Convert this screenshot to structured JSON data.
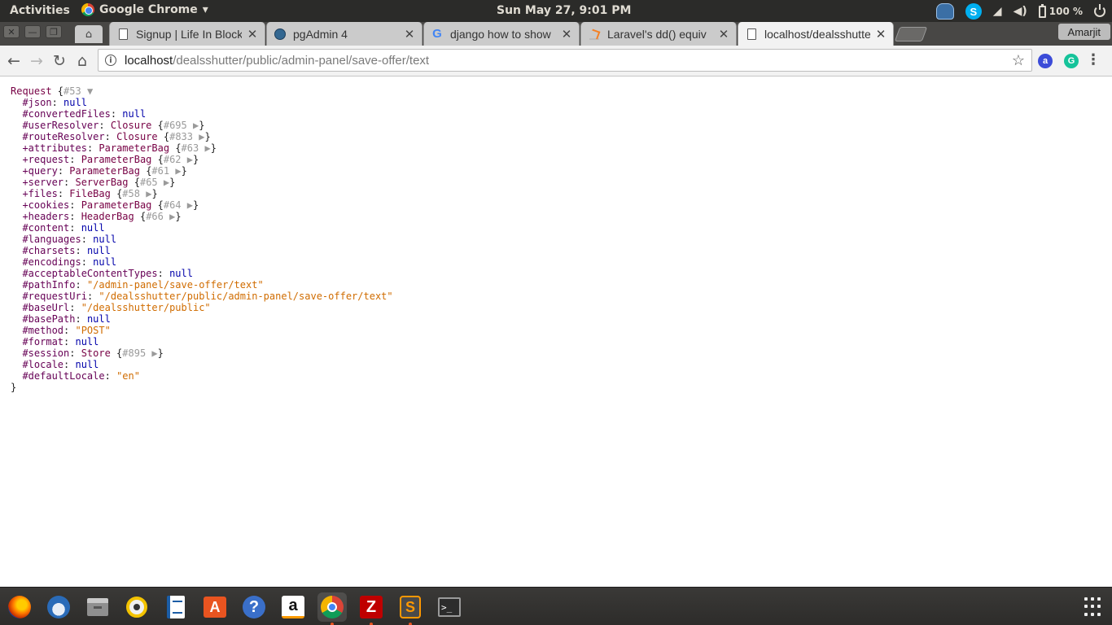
{
  "top_panel": {
    "activities": "Activities",
    "app_name": "Google Chrome",
    "app_menu_arrow": "▾",
    "clock": "Sun May 27,  9:01 PM",
    "battery": "100 %"
  },
  "window_controls": {
    "close": "✕",
    "minimize": "—",
    "maximize": "❐"
  },
  "tabs": [
    {
      "title": "Signup | Life In Block",
      "icon": "page-icon",
      "close": "✕"
    },
    {
      "title": "pgAdmin 4",
      "icon": "postgres-elephant-icon",
      "close": "✕"
    },
    {
      "title": "django how to show",
      "icon": "google-icon",
      "close": "✕"
    },
    {
      "title": "Laravel's dd() equiv",
      "icon": "stackoverflow-icon",
      "close": "✕"
    },
    {
      "title": "localhost/dealsshutter",
      "icon": "page-icon",
      "close": "✕",
      "active": true
    }
  ],
  "profile_name": "Amarjit",
  "toolbar": {
    "back": "←",
    "forward": "→",
    "reload": "↻",
    "home": "⌂",
    "info": "i",
    "url_host": "localhost",
    "url_path": "/dealsshutter/public/admin-panel/save-offer/text",
    "bookmark_star": "☆",
    "menu": "⋮"
  },
  "dump": {
    "class": "Request",
    "object_id": "#53",
    "expanded_arrow": "▼",
    "collapsed_arrow": "▶",
    "props": [
      {
        "key": "#json",
        "type": "null",
        "value": "null"
      },
      {
        "key": "#convertedFiles",
        "type": "null",
        "value": "null"
      },
      {
        "key": "#userResolver",
        "type": "object",
        "value": "Closure",
        "id": "#695"
      },
      {
        "key": "#routeResolver",
        "type": "object",
        "value": "Closure",
        "id": "#833"
      },
      {
        "key": "+attributes",
        "type": "object",
        "value": "ParameterBag",
        "id": "#63"
      },
      {
        "key": "+request",
        "type": "object",
        "value": "ParameterBag",
        "id": "#62"
      },
      {
        "key": "+query",
        "type": "object",
        "value": "ParameterBag",
        "id": "#61"
      },
      {
        "key": "+server",
        "type": "object",
        "value": "ServerBag",
        "id": "#65"
      },
      {
        "key": "+files",
        "type": "object",
        "value": "FileBag",
        "id": "#58"
      },
      {
        "key": "+cookies",
        "type": "object",
        "value": "ParameterBag",
        "id": "#64"
      },
      {
        "key": "+headers",
        "type": "object",
        "value": "HeaderBag",
        "id": "#66"
      },
      {
        "key": "#content",
        "type": "null",
        "value": "null"
      },
      {
        "key": "#languages",
        "type": "null",
        "value": "null"
      },
      {
        "key": "#charsets",
        "type": "null",
        "value": "null"
      },
      {
        "key": "#encodings",
        "type": "null",
        "value": "null"
      },
      {
        "key": "#acceptableContentTypes",
        "type": "null",
        "value": "null"
      },
      {
        "key": "#pathInfo",
        "type": "string",
        "value": "\"/admin-panel/save-offer/text\""
      },
      {
        "key": "#requestUri",
        "type": "string",
        "value": "\"/dealsshutter/public/admin-panel/save-offer/text\""
      },
      {
        "key": "#baseUrl",
        "type": "string",
        "value": "\"/dealsshutter/public\""
      },
      {
        "key": "#basePath",
        "type": "null",
        "value": "null"
      },
      {
        "key": "#method",
        "type": "string",
        "value": "\"POST\""
      },
      {
        "key": "#format",
        "type": "null",
        "value": "null"
      },
      {
        "key": "#session",
        "type": "object",
        "value": "Store",
        "id": "#895"
      },
      {
        "key": "#locale",
        "type": "null",
        "value": "null"
      },
      {
        "key": "#defaultLocale",
        "type": "string",
        "value": "\"en\""
      }
    ]
  },
  "dock": [
    {
      "name": "firefox",
      "icon": "firefox-icon"
    },
    {
      "name": "thunderbird",
      "icon": "thunderbird-icon"
    },
    {
      "name": "files",
      "icon": "files-icon"
    },
    {
      "name": "rhythmbox",
      "icon": "rhythmbox-icon"
    },
    {
      "name": "libreoffice-writer",
      "icon": "writer-icon"
    },
    {
      "name": "software-center",
      "icon": "software-icon",
      "glyph": "A"
    },
    {
      "name": "help",
      "icon": "help-icon",
      "glyph": "?"
    },
    {
      "name": "amazon",
      "icon": "amazon-icon",
      "glyph": "a"
    },
    {
      "name": "chrome",
      "icon": "chrome-icon",
      "running": true,
      "focused": true
    },
    {
      "name": "filezilla",
      "icon": "filezilla-icon",
      "glyph": "Z",
      "running": true
    },
    {
      "name": "sublime-text",
      "icon": "sublime-icon",
      "glyph": "S",
      "running": true
    },
    {
      "name": "terminal",
      "icon": "terminal-icon",
      "glyph": ">_"
    }
  ],
  "colors": {
    "panel_bg": "#2b2b29",
    "tab_strip_bg": "#484745",
    "dump_class": "#770044",
    "dump_key": "#660055",
    "dump_null": "#0000aa",
    "dump_string": "#d06c00",
    "dump_id": "#9a9a9a",
    "dock_running_dot": "#e95420"
  }
}
